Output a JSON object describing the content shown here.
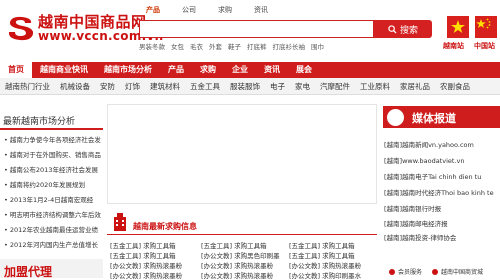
{
  "header": {
    "logo_cn": "越南中国商品网",
    "logo_url": "www.vccn.com.vn",
    "search_tabs": [
      "产品",
      "公司",
      "求购",
      "资讯"
    ],
    "search_placeholder": "",
    "search_button": "搜索",
    "hot_words": [
      "男装冬款",
      "女包",
      "毛衣",
      "外套",
      "鞋子",
      "打底裤",
      "打底衫长袖",
      "围巾"
    ],
    "flag_vn_label": "越南站",
    "flag_cn_label": "中国站"
  },
  "main_nav": [
    "首页",
    "越南商业快讯",
    "越南市场分析",
    "产品",
    "求购",
    "企业",
    "资讯",
    "展会"
  ],
  "sub_nav": [
    "越南热门行业",
    "机械设备",
    "安防",
    "灯饰",
    "建筑材料",
    "五金工具",
    "服装服饰",
    "电子",
    "家电",
    "汽摩配件",
    "工业原料",
    "家居礼品",
    "农副食品"
  ],
  "left": {
    "title": "最新越南市场分析",
    "items": [
      "越南力争使今年各项经济社会发",
      "越南对于在外国购买、销售商品",
      "越南公布2013年经济社会发展",
      "越南将约2020年发展规划",
      "2013年1月2-4日越南宏观经",
      "明志明市经济结构调整六年后效",
      "2012年农业越南最佳运营业绩",
      "2012年河内国内生产总值增长"
    ],
    "banner": "加盟代理"
  },
  "news": {
    "title": "越南最新求购信息",
    "rows": [
      [
        "[五金工具] 求购工具箱",
        "[五金工具] 求购工具箱",
        "[五金工具] 求购工具箱"
      ],
      [
        "[五金工具] 求购工具箱",
        "[办公文教] 求购黑色印刷墨",
        "[五金工具] 求购工具箱"
      ],
      [
        "[办公文教] 求购热滚墨粉",
        "[办公文教] 求购热滚墨粉",
        "[办公文教] 求购热滚墨粉"
      ],
      [
        "[办公文教] 求购热滚墨粉",
        "[办公文教] 求购热滚墨粉",
        "[办公文教] 求购印刷墨水"
      ]
    ]
  },
  "right": {
    "title": "媒体报道",
    "items": [
      "[越南]越南新闻vn.yahoo.com",
      "[越南]www.baodatviet.vn",
      "[越南]越南电子Tai chinh dien tu",
      "[越南]越南时代经济Thoi bao kinh te",
      "[越南]越南银行时报",
      "[越南]越南邮电经济报",
      "[越南]越南投资-律师协会"
    ],
    "footer": [
      "会员服务",
      "越南中国商贸城"
    ]
  }
}
